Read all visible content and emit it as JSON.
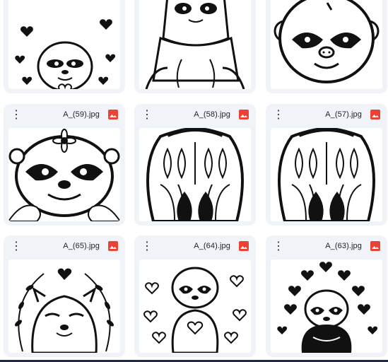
{
  "colors": {
    "card_bg": "#f0f4f9",
    "image_badge": "#ea4335",
    "text": "#1f1f1f"
  },
  "icons": {
    "menu": "more-vertical-icon",
    "file_type": "image-file-icon"
  },
  "files": {
    "row1": [
      {
        "name": ""
      },
      {
        "name": ""
      },
      {
        "name": ""
      }
    ],
    "row2": [
      {
        "name": "A_(59).jpg"
      },
      {
        "name": "A_(58).jpg"
      },
      {
        "name": "A_(57).jpg"
      }
    ],
    "row3": [
      {
        "name": "A_(65).jpg"
      },
      {
        "name": "A_(64).jpg"
      },
      {
        "name": "A_(63).jpg"
      }
    ]
  }
}
